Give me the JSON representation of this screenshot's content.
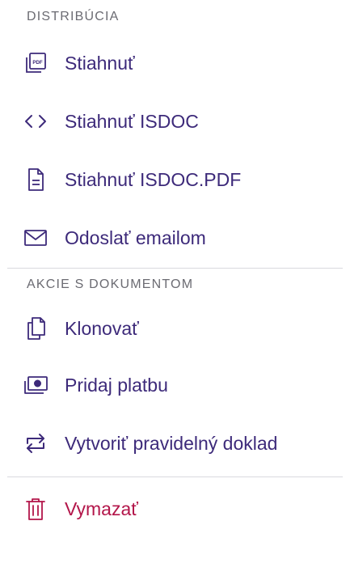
{
  "sections": {
    "distribution": {
      "title": "DISTRIBÚCIA",
      "items": [
        {
          "label": "Stiahnuť",
          "icon": "pdf-icon"
        },
        {
          "label": "Stiahnuť ISDOC",
          "icon": "code-icon"
        },
        {
          "label": "Stiahnuť ISDOC.PDF",
          "icon": "document-icon"
        },
        {
          "label": "Odoslať emailom",
          "icon": "mail-icon"
        }
      ]
    },
    "actions": {
      "title": "AKCIE S DOKUMENTOM",
      "items": [
        {
          "label": "Klonovať",
          "icon": "copy-icon"
        },
        {
          "label": "Pridaj platbu",
          "icon": "money-icon"
        },
        {
          "label": "Vytvoriť pravidelný doklad",
          "icon": "repeat-icon"
        }
      ]
    },
    "danger": {
      "items": [
        {
          "label": "Vymazať",
          "icon": "trash-icon"
        }
      ]
    }
  },
  "colors": {
    "text": "#3d2a7a",
    "danger": "#b3164a",
    "section_header": "#6b6b72",
    "divider": "#d9d9de"
  }
}
